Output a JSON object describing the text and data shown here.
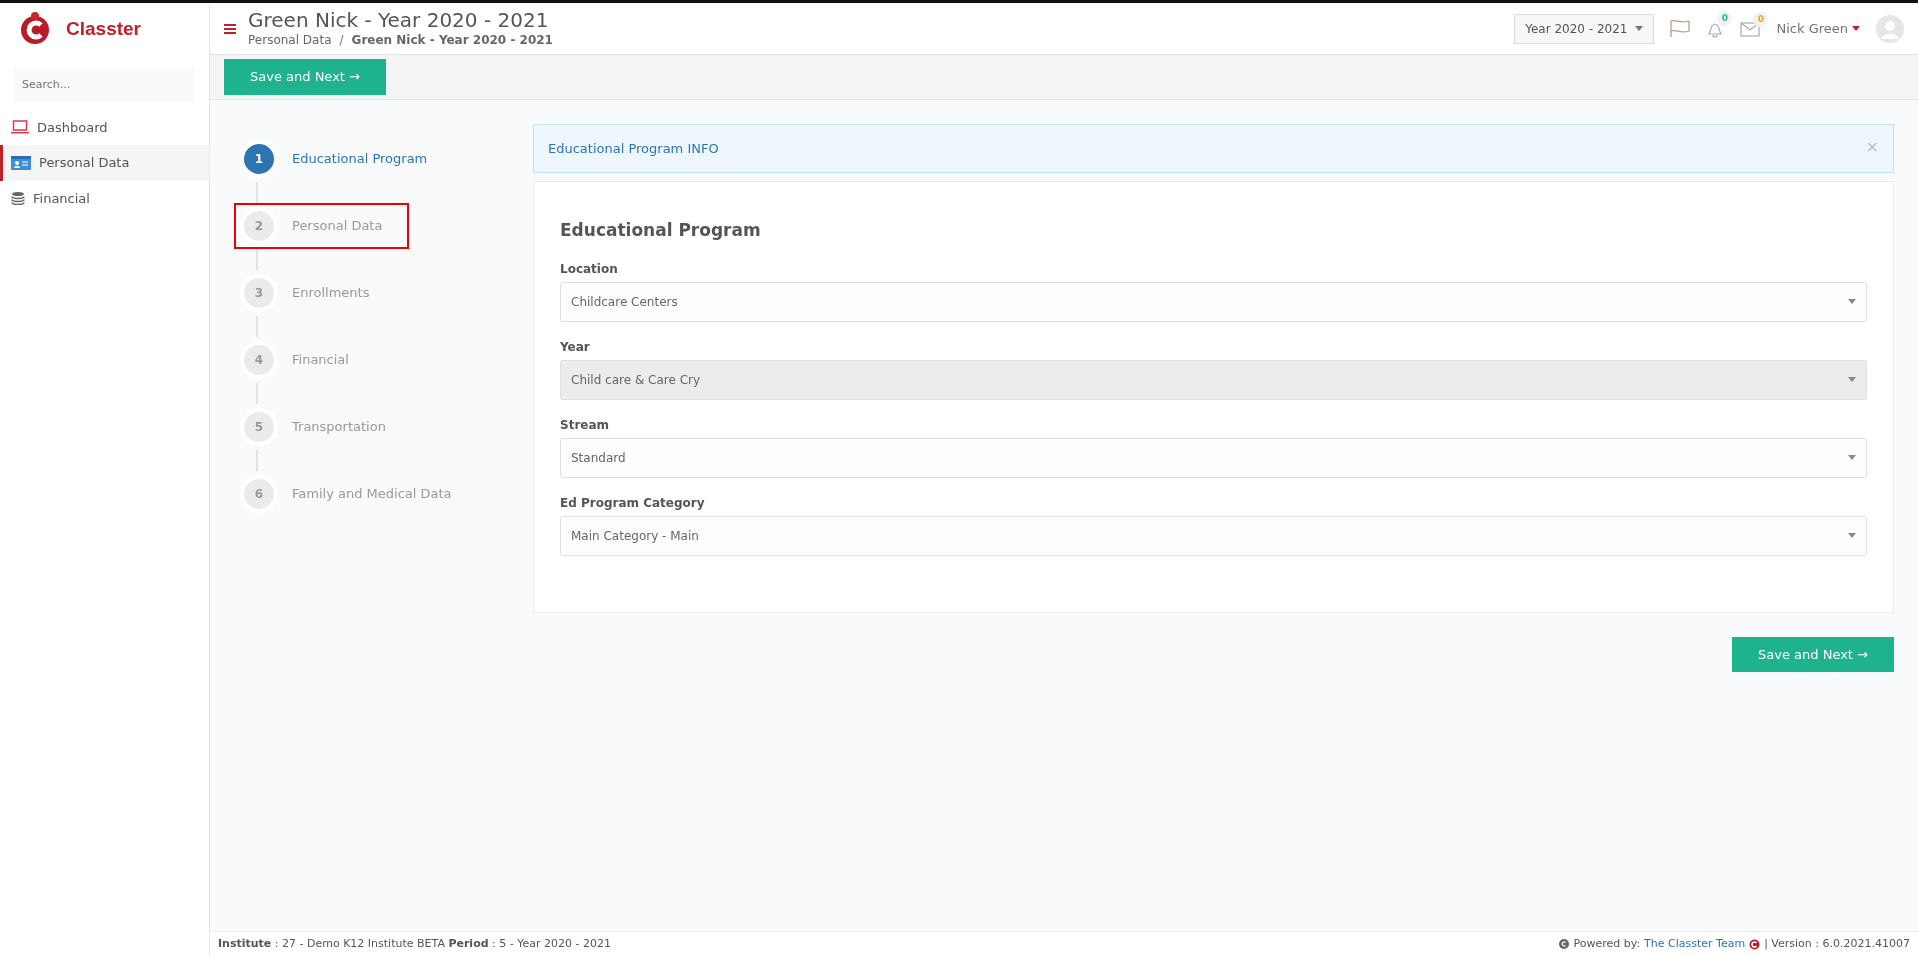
{
  "sidebar": {
    "logo_text": "Classter",
    "search": {
      "placeholder": "Search..."
    },
    "items": [
      {
        "label": "Dashboard",
        "kind": "laptop",
        "selected": false
      },
      {
        "label": "Personal Data",
        "kind": "card",
        "selected": true
      },
      {
        "label": "Financial",
        "kind": "coins",
        "selected": false
      }
    ]
  },
  "header": {
    "title": "Green Nick - Year 2020 - 2021",
    "breadcrumb": [
      "Personal Data",
      "Green Nick - Year 2020 - 2021"
    ],
    "breadcrumb_separator": "/",
    "year_select": "Year 2020 - 2021",
    "notifications": [
      {
        "kind": "bell",
        "count": "0",
        "color": "#1abc9c"
      },
      {
        "kind": "mail",
        "count": "0",
        "color": "#f0a030"
      }
    ],
    "user": "Nick Green"
  },
  "toolbar": {
    "button": "Save and Next →"
  },
  "steps": [
    {
      "number": "1",
      "label": "Educational Program",
      "selected": true,
      "highlighted": false
    },
    {
      "number": "2",
      "label": "Personal Data",
      "selected": false,
      "highlighted": true
    },
    {
      "number": "3",
      "label": "Enrollments",
      "selected": false,
      "highlighted": false
    },
    {
      "number": "4",
      "label": "Financial",
      "selected": false,
      "highlighted": false
    },
    {
      "number": "5",
      "label": "Transportation",
      "selected": false,
      "highlighted": false
    },
    {
      "number": "6",
      "label": "Family and Medical Data",
      "selected": false,
      "highlighted": false
    }
  ],
  "info": {
    "text": "Educational Program INFO",
    "close": "×"
  },
  "form": {
    "title": "Educational Program",
    "fields": [
      {
        "label": "Location",
        "value": "Childcare Centers",
        "disabled": false
      },
      {
        "label": "Year",
        "value": "Child care & Care Cry",
        "disabled": true
      },
      {
        "label": "Stream",
        "value": "Standard",
        "disabled": false
      },
      {
        "label": "Ed Program Category",
        "value": "Main Category - Main",
        "disabled": false
      }
    ]
  },
  "save_button": "Save and Next →",
  "footer": {
    "left": "**Institute** : 27 - Demo K12 Institute BETA **Period** : 5 - Year 2020 - 2021",
    "powered": "Powered by:",
    "link": "The Classter Team",
    "version": "| Version : 6.0.2021.41007"
  }
}
